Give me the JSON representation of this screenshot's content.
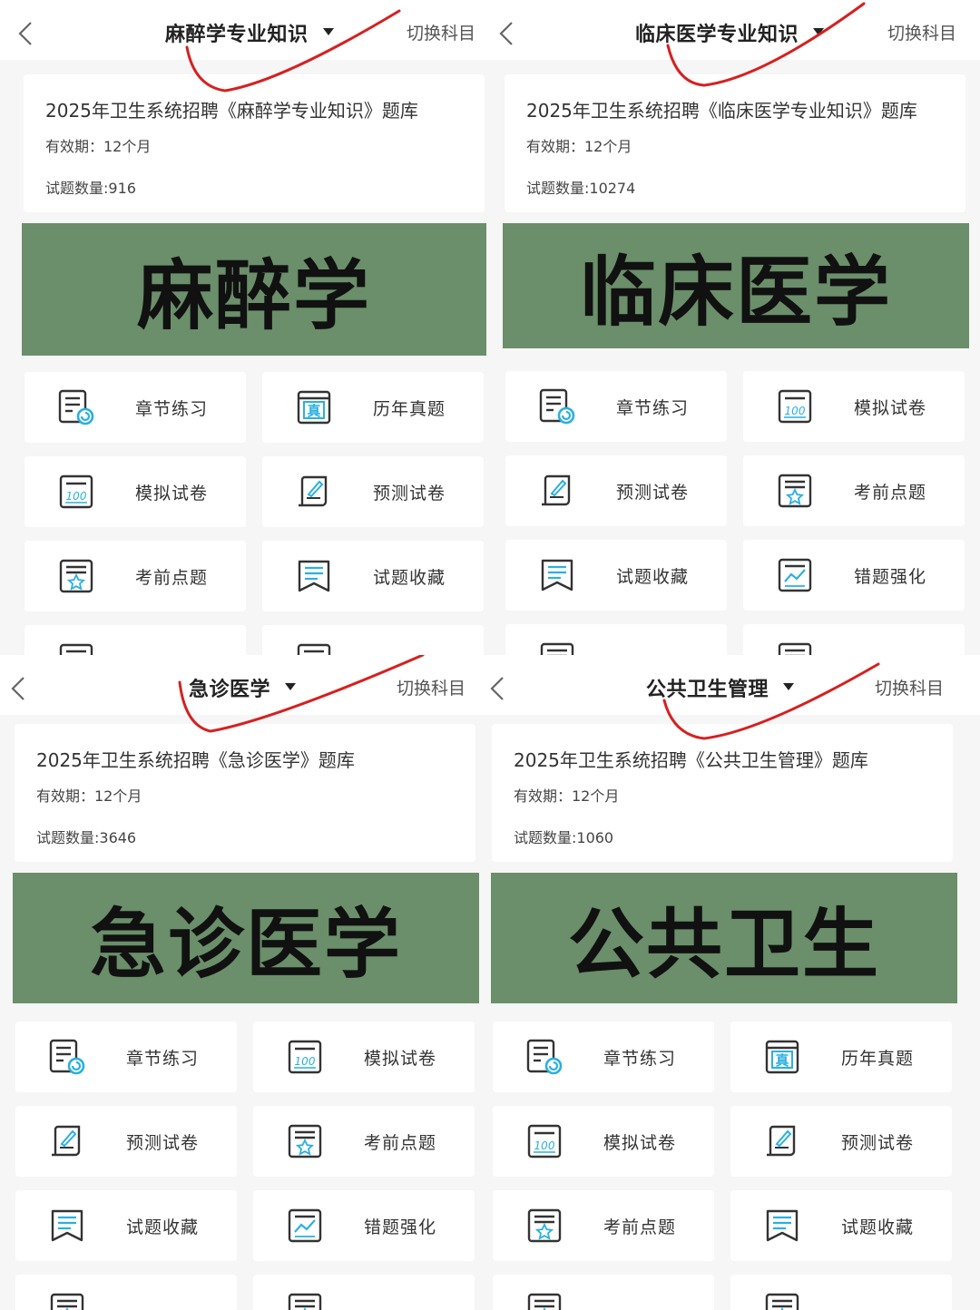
{
  "common": {
    "switch_label": "切换科目",
    "validity": "有效期：12个月"
  },
  "colors": {
    "banner_green": "#6a8f6a",
    "icon_blue": "#2ab0e0",
    "annotation_red": "#d62020"
  },
  "panels": [
    {
      "title": "麻醉学专业知识",
      "bank_title": "2025年卫生系统招聘《麻醉学专业知识》题库",
      "count": "试题数量:916",
      "banner": "麻醉学",
      "tiles": [
        {
          "label": "章节练习",
          "icon": "chapter-practice"
        },
        {
          "label": "历年真题",
          "icon": "past-exam"
        },
        {
          "label": "模拟试卷",
          "icon": "mock-paper"
        },
        {
          "label": "预测试卷",
          "icon": "forecast-paper"
        },
        {
          "label": "考前点题",
          "icon": "key-points"
        },
        {
          "label": "试题收藏",
          "icon": "favorites"
        }
      ]
    },
    {
      "title": "临床医学专业知识",
      "bank_title": "2025年卫生系统招聘《临床医学专业知识》题库",
      "count": "试题数量:10274",
      "banner": "临床医学",
      "tiles": [
        {
          "label": "章节练习",
          "icon": "chapter-practice"
        },
        {
          "label": "模拟试卷",
          "icon": "mock-paper"
        },
        {
          "label": "预测试卷",
          "icon": "forecast-paper"
        },
        {
          "label": "考前点题",
          "icon": "key-points"
        },
        {
          "label": "试题收藏",
          "icon": "favorites"
        },
        {
          "label": "错题强化",
          "icon": "mistakes"
        }
      ]
    },
    {
      "title": "急诊医学",
      "bank_title": "2025年卫生系统招聘《急诊医学》题库",
      "count": "试题数量:3646",
      "banner": "急诊医学",
      "tiles": [
        {
          "label": "章节练习",
          "icon": "chapter-practice"
        },
        {
          "label": "模拟试卷",
          "icon": "mock-paper"
        },
        {
          "label": "预测试卷",
          "icon": "forecast-paper"
        },
        {
          "label": "考前点题",
          "icon": "key-points"
        },
        {
          "label": "试题收藏",
          "icon": "favorites"
        },
        {
          "label": "错题强化",
          "icon": "mistakes"
        }
      ]
    },
    {
      "title": "公共卫生管理",
      "bank_title": "2025年卫生系统招聘《公共卫生管理》题库",
      "count": "试题数量:1060",
      "banner": "公共卫生",
      "tiles": [
        {
          "label": "章节练习",
          "icon": "chapter-practice"
        },
        {
          "label": "历年真题",
          "icon": "past-exam"
        },
        {
          "label": "模拟试卷",
          "icon": "mock-paper"
        },
        {
          "label": "预测试卷",
          "icon": "forecast-paper"
        },
        {
          "label": "考前点题",
          "icon": "key-points"
        },
        {
          "label": "试题收藏",
          "icon": "favorites"
        }
      ]
    }
  ]
}
